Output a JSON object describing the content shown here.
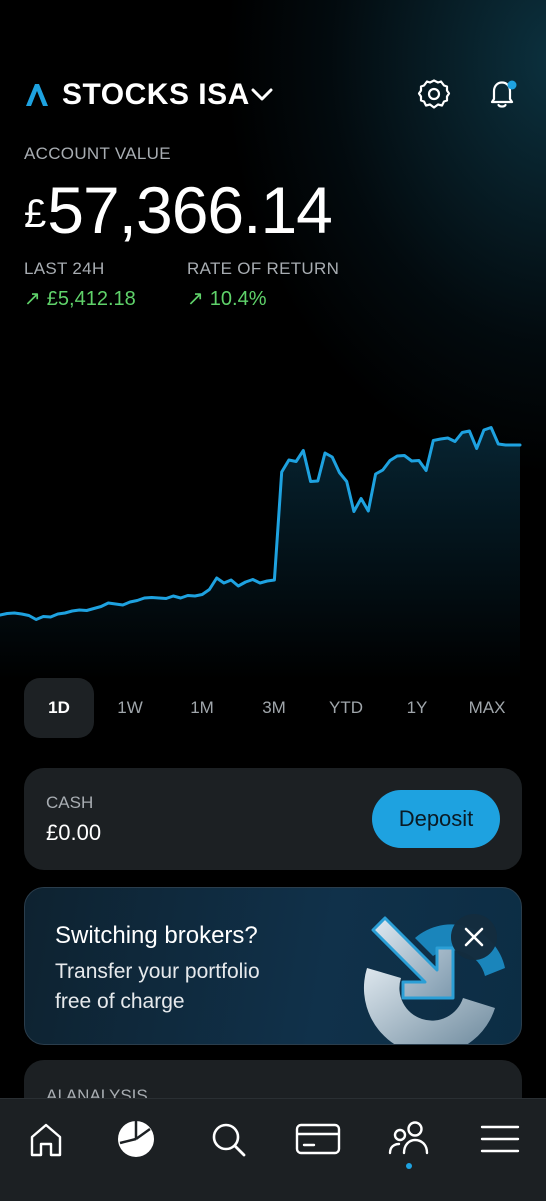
{
  "header": {
    "account_title": "STOCKS ISA",
    "icons": [
      "logo-icon",
      "chevron-down-icon",
      "gear-icon",
      "bell-icon"
    ],
    "bell_has_notification": true
  },
  "account": {
    "value_label": "ACCOUNT VALUE",
    "currency": "£",
    "value": "57,366.14",
    "stats": [
      {
        "label": "LAST 24H",
        "value": "£5,412.18",
        "trend": "up"
      },
      {
        "label": "RATE OF RETURN",
        "value": "10.4%",
        "trend": "up"
      }
    ]
  },
  "chart_data": {
    "type": "line",
    "title": "",
    "series": [
      {
        "values": [
          50,
          53,
          54,
          52,
          49,
          41,
          47,
          46,
          52,
          54,
          58,
          60,
          59,
          63,
          67,
          74,
          72,
          70,
          76,
          79,
          84,
          85,
          84,
          83,
          88,
          84,
          89,
          88,
          91,
          101,
          124,
          114,
          120,
          108,
          116,
          121,
          114,
          118,
          120,
          336,
          360,
          357,
          379,
          317,
          318,
          374,
          366,
          335,
          317,
          257,
          283,
          258,
          332,
          340,
          359,
          368,
          369,
          358,
          359,
          339,
          399,
          402,
          404,
          397,
          415,
          418,
          383,
          420,
          425,
          392,
          390,
          390,
          390
        ]
      }
    ],
    "color": "#1ea2e0"
  },
  "ranges": {
    "items": [
      "1D",
      "1W",
      "1M",
      "3M",
      "YTD",
      "1Y",
      "MAX"
    ],
    "selected": "1D"
  },
  "cash": {
    "label": "CASH",
    "value": "£0.00",
    "deposit_label": "Deposit"
  },
  "promo": {
    "title": "Switching brokers?",
    "line1": "Transfer your portfolio",
    "line2": "free of charge"
  },
  "ai": {
    "label": "AI ANALYSIS"
  },
  "nav": {
    "items": [
      "home-icon",
      "portfolio-icon",
      "search-icon",
      "card-icon",
      "community-icon",
      "menu-icon"
    ],
    "active": "community-icon"
  },
  "colors": {
    "accent": "#1ea2e0",
    "positive": "#5fd26a",
    "card": "#1c2023"
  }
}
